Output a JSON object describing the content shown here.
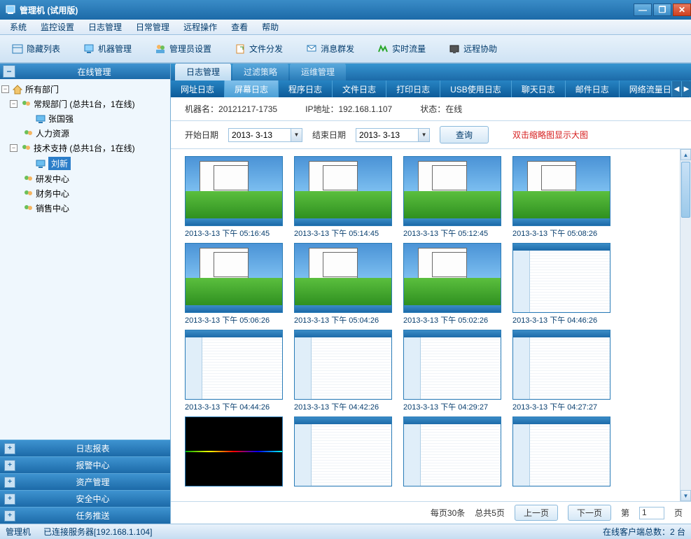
{
  "window_title": "管理机 (试用版)",
  "winctrl": {
    "min": "—",
    "max": "❐",
    "close": "✕"
  },
  "menu": [
    "系统",
    "监控设置",
    "日志管理",
    "日常管理",
    "远程操作",
    "查看",
    "帮助"
  ],
  "toolbar": [
    {
      "label": "隐藏列表",
      "icon": "hide"
    },
    {
      "label": "机器管理",
      "icon": "pc"
    },
    {
      "label": "管理员设置",
      "icon": "admin"
    },
    {
      "label": "文件分发",
      "icon": "file"
    },
    {
      "label": "消息群发",
      "icon": "msg"
    },
    {
      "label": "实时流量",
      "icon": "wave"
    },
    {
      "label": "远程协助",
      "icon": "screen"
    }
  ],
  "sidebar": {
    "header": "在线管理",
    "collapse": "−",
    "tree": {
      "root": {
        "label": "所有部门",
        "expand": "−"
      },
      "dept1": {
        "label": "常规部门 (总共1台，1在线)",
        "expand": "−"
      },
      "user1": "张国强",
      "hr": "人力资源",
      "dept2": {
        "label": "技术支持 (总共1台，1在线)",
        "expand": "−"
      },
      "user2": "刘新",
      "rd": "研发中心",
      "fin": "财务中心",
      "sales": "销售中心"
    },
    "bottom": [
      "日志报表",
      "报警中心",
      "资产管理",
      "安全中心",
      "任务推送"
    ]
  },
  "top_tabs": [
    "日志管理",
    "过滤策略",
    "运维管理"
  ],
  "sub_tabs": [
    "网址日志",
    "屏幕日志",
    "程序日志",
    "文件日志",
    "打印日志",
    "USB使用日志",
    "聊天日志",
    "邮件日志",
    "网络流量日志"
  ],
  "info": {
    "machine_lbl": "机器名：",
    "machine_val": "20121217-1735",
    "ip_lbl": "IP地址：",
    "ip_val": "192.168.1.107",
    "status_lbl": "状态：",
    "status_val": "在线"
  },
  "search": {
    "start_lbl": "开始日期",
    "start_val": "2013- 3-13",
    "end_lbl": "结束日期",
    "end_val": "2013- 3-13",
    "btn": "查询",
    "hint": "双击缩略图显示大图"
  },
  "thumbs": [
    {
      "t": "desktop",
      "cap": "2013-3-13 下午 05:16:45"
    },
    {
      "t": "desktop",
      "cap": "2013-3-13 下午 05:14:45"
    },
    {
      "t": "desktop",
      "cap": "2013-3-13 下午 05:12:45"
    },
    {
      "t": "desktop",
      "cap": "2013-3-13 下午 05:08:26"
    },
    {
      "t": "desktop",
      "cap": "2013-3-13 下午 05:06:26"
    },
    {
      "t": "desktop",
      "cap": "2013-3-13 下午 05:04:26"
    },
    {
      "t": "desktop",
      "cap": "2013-3-13 下午 05:02:26"
    },
    {
      "t": "app",
      "cap": "2013-3-13 下午 04:46:26"
    },
    {
      "t": "app",
      "cap": "2013-3-13 下午 04:44:26"
    },
    {
      "t": "app",
      "cap": "2013-3-13 下午 04:42:26"
    },
    {
      "t": "app",
      "cap": "2013-3-13 下午 04:29:27"
    },
    {
      "t": "app",
      "cap": "2013-3-13 下午 04:27:27"
    },
    {
      "t": "black",
      "cap": ""
    },
    {
      "t": "app",
      "cap": ""
    },
    {
      "t": "app",
      "cap": ""
    },
    {
      "t": "app",
      "cap": ""
    }
  ],
  "pager": {
    "perpage": "每页30条",
    "total": "总共5页",
    "prev": "上一页",
    "next": "下一页",
    "pglbl": "第",
    "pgval": "1",
    "pgsfx": "页"
  },
  "status": {
    "left1": "管理机",
    "left2": "已连接服务器[192.168.1.104]",
    "right_lbl": "在线客户端总数：",
    "right_val": "2 台"
  }
}
